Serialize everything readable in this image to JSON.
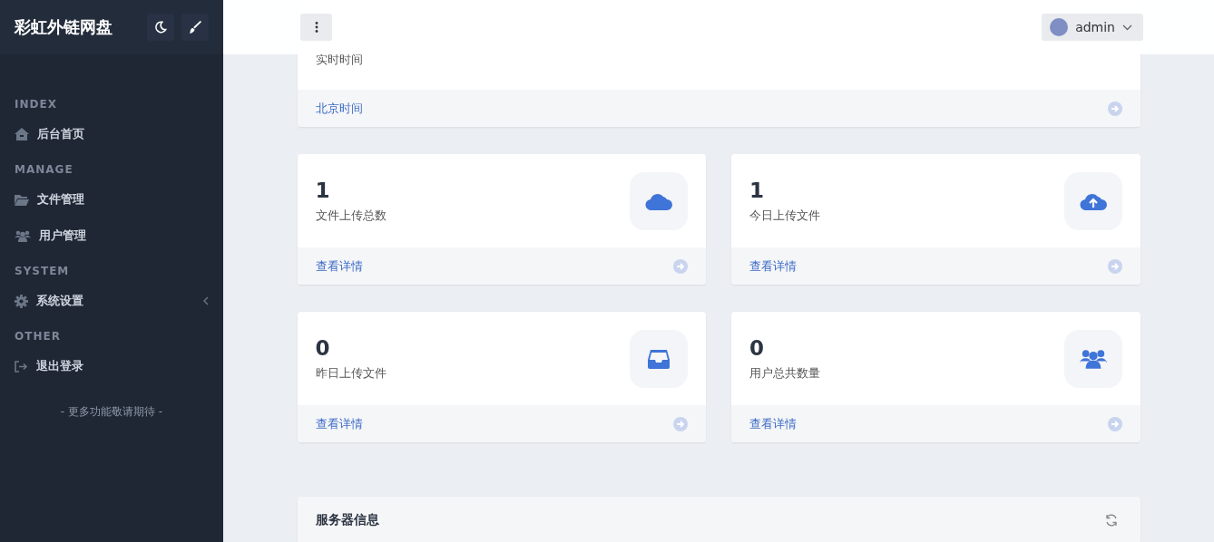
{
  "sidebar": {
    "brand": "彩虹外链网盘",
    "sections": [
      {
        "heading": "INDEX",
        "items": [
          {
            "label": "后台首页",
            "kind": "home",
            "submenu": false
          }
        ]
      },
      {
        "heading": "MANAGE",
        "items": [
          {
            "label": "文件管理",
            "kind": "folder",
            "submenu": false
          },
          {
            "label": "用户管理",
            "kind": "users",
            "submenu": false
          }
        ]
      },
      {
        "heading": "SYSTEM",
        "items": [
          {
            "label": "系统设置",
            "kind": "gear",
            "submenu": true
          }
        ]
      },
      {
        "heading": "OTHER",
        "items": [
          {
            "label": "退出登录",
            "kind": "logout",
            "submenu": false
          }
        ]
      }
    ],
    "footer_note": "- 更多功能敬请期待 -"
  },
  "header": {
    "user": "admin"
  },
  "time_card": {
    "label": "实时时间",
    "link": "北京时间"
  },
  "stat_cards": [
    {
      "value": "1",
      "label": "文件上传总数",
      "link": "查看详情",
      "kind": "cloud"
    },
    {
      "value": "1",
      "label": "今日上传文件",
      "link": "查看详情",
      "kind": "upload"
    },
    {
      "value": "0",
      "label": "昨日上传文件",
      "link": "查看详情",
      "kind": "inbox"
    },
    {
      "value": "0",
      "label": "用户总共数量",
      "link": "查看详情",
      "kind": "users"
    }
  ],
  "server_panel": {
    "title": "服务器信息"
  }
}
